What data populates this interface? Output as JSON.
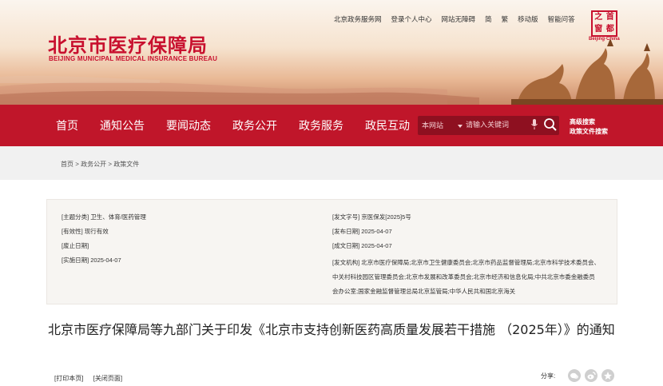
{
  "header": {
    "logo_cn": "北京市医疗保障局",
    "logo_en": "BEIJING MUNICIPAL MEDICAL INSURANCE BUREAU",
    "top_links": [
      "北京政务服务网",
      "登录个人中心",
      "网站无障碍",
      "简",
      "繁",
      "移动版",
      "智能问答"
    ],
    "seal_chars": [
      "之",
      "首",
      "窗",
      "都"
    ],
    "seal_sub": "Beijing·China"
  },
  "nav": {
    "items": [
      "首页",
      "通知公告",
      "要闻动态",
      "政务公开",
      "政务服务",
      "政民互动"
    ],
    "search_scope": "本网站",
    "search_placeholder": "请输入关键词",
    "advanced_search": "高级搜索",
    "policy_search": "政策文件搜索"
  },
  "breadcrumb": {
    "text": "首页 > 政务公开 > 政策文件"
  },
  "meta": {
    "left": [
      "[主题分类] 卫生、体育/医药管理",
      "[有效性] 现行有效",
      "[废止日期]",
      "[实施日期] 2025-04-07"
    ],
    "right": [
      "[发文字号] 京医保发[2025]5号",
      "[发布日期] 2025-04-07",
      "[成文日期] 2025-04-07"
    ],
    "org": "[发文机构] 北京市医疗保障局;北京市卫生健康委员会;北京市药品监督管理局;北京市科学技术委员会、中关村科技园区管理委员会;北京市发展和改革委员会;北京市经济和信息化局;中共北京市委金融委员会办公室;国家金融监督管理总局北京监管局;中华人民共和国北京海关"
  },
  "article": {
    "title": "北京市医疗保障局等九部门关于印发《北京市支持创新医药高质量发展若干措施 （2025年）》的通知"
  },
  "tools": {
    "print": "[打印本页]",
    "close": "[关闭页面]",
    "share_label": "分享:"
  },
  "colors": {
    "brand_red": "#c0162a",
    "search_bg": "#8e1020",
    "meta_bg": "#f7f5f2"
  }
}
